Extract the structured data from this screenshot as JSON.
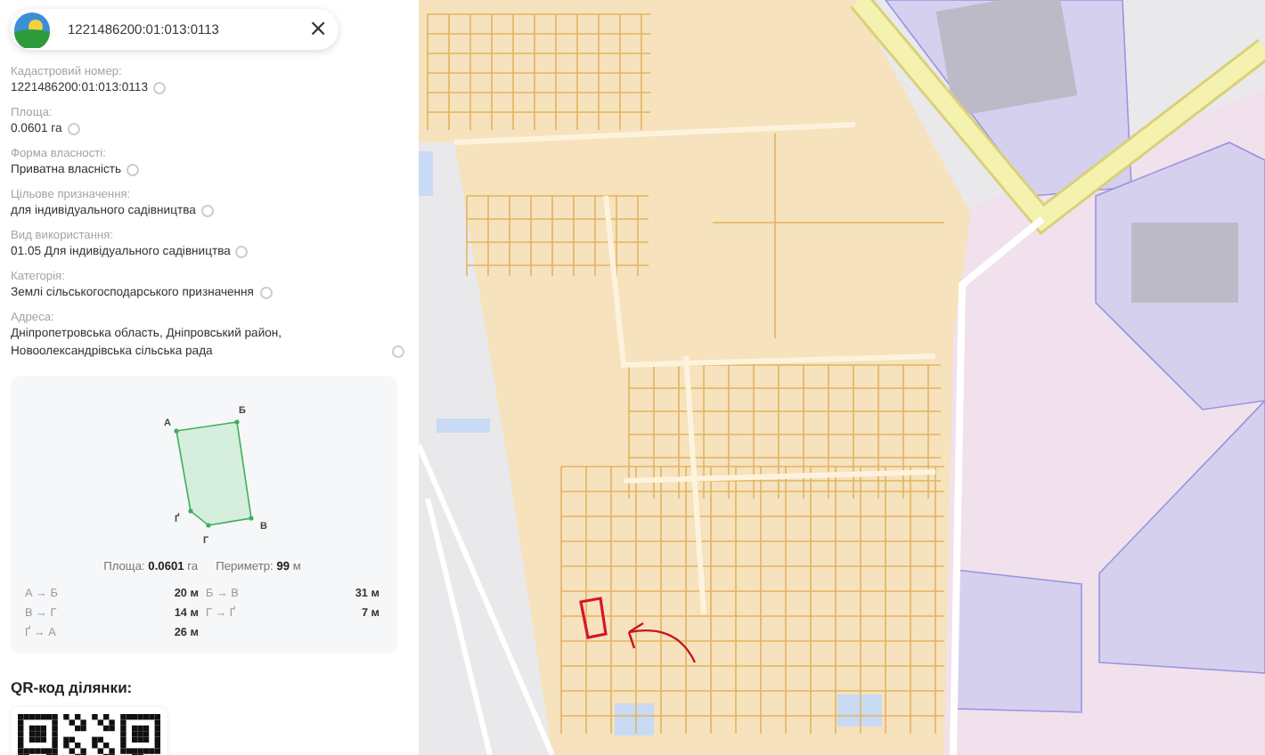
{
  "search": {
    "value": "1221486200:01:013:0113",
    "close": "×"
  },
  "fields": [
    {
      "label": "Кадастровий номер:",
      "value": "1221486200:01:013:0113"
    },
    {
      "label": "Площа:",
      "value": "0.0601 га"
    },
    {
      "label": "Форма власності:",
      "value": "Приватна власність"
    },
    {
      "label": "Цільове призначення:",
      "value": "для індивідуального садівництва"
    },
    {
      "label": "Вид використання:",
      "value": "01.05 Для індивідуального садівництва"
    },
    {
      "label": "Категорія:",
      "value": "Землі сільськогосподарського призначення"
    },
    {
      "label": "Адреса:",
      "value": "Дніпропетровська область, Дніпровський район, Новоолександрівська сільська рада"
    }
  ],
  "plot": {
    "vertices": [
      "А",
      "Б",
      "В",
      "Г",
      "Ґ"
    ],
    "area": "Площа: **0.0601** га",
    "perimeter": "Периметр: **99** м",
    "segments": [
      {
        "name": "А → Б",
        "length": "20 м"
      },
      {
        "name": "Б → В",
        "length": "31 м"
      },
      {
        "name": "В → Г",
        "length": "14 м"
      },
      {
        "name": "Г → Ґ",
        "length": "7 м"
      },
      {
        "name": "Ґ → А",
        "length": "26 м"
      }
    ]
  },
  "qr": {
    "title": "QR-код ділянки:"
  }
}
